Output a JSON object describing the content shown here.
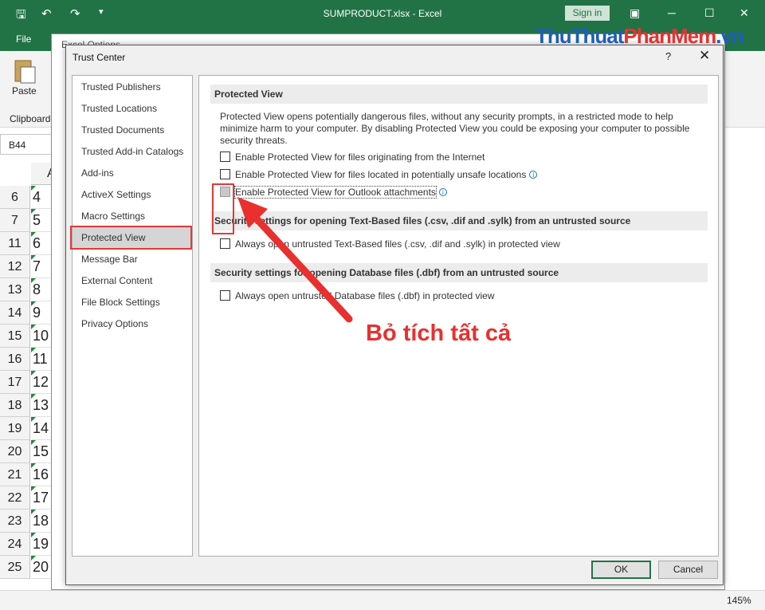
{
  "excel": {
    "doc_title": "SUMPRODUCT.xlsx  -  Excel",
    "sign_in": "Sign in",
    "file_tab": "File",
    "paste": "Paste",
    "clipboard": "Clipboard",
    "name_box": "B44",
    "col_a": "A",
    "rows": [
      {
        "head": "6",
        "val": "4"
      },
      {
        "head": "7",
        "val": "5"
      },
      {
        "head": "11",
        "val": "6"
      },
      {
        "head": "12",
        "val": "7"
      },
      {
        "head": "13",
        "val": "8"
      },
      {
        "head": "14",
        "val": "9"
      },
      {
        "head": "15",
        "val": "10"
      },
      {
        "head": "16",
        "val": "11"
      },
      {
        "head": "17",
        "val": "12"
      },
      {
        "head": "18",
        "val": "13"
      },
      {
        "head": "19",
        "val": "14"
      },
      {
        "head": "20",
        "val": "15"
      },
      {
        "head": "21",
        "val": "16"
      },
      {
        "head": "22",
        "val": "17"
      },
      {
        "head": "23",
        "val": "18"
      },
      {
        "head": "24",
        "val": "19"
      },
      {
        "head": "25",
        "val": "20"
      }
    ],
    "zoom": "145%",
    "accent": "#217346"
  },
  "excel_options": {
    "title": "Excel Options"
  },
  "dialog": {
    "title": "Trust Center",
    "help": "?",
    "close": "✕",
    "nav": [
      "Trusted Publishers",
      "Trusted Locations",
      "Trusted Documents",
      "Trusted Add-in Catalogs",
      "Add-ins",
      "ActiveX Settings",
      "Macro Settings",
      "Protected View",
      "Message Bar",
      "External Content",
      "File Block Settings",
      "Privacy Options"
    ],
    "selected_nav": "Protected View",
    "section1": "Protected View",
    "description": "Protected View opens potentially dangerous files, without any security prompts, in a restricted mode to help minimize harm to your computer. By disabling Protected View you could be exposing your computer to possible security threats.",
    "opt1": "Enable Protected View for files originating from the Internet",
    "opt2": "Enable Protected View for files located in potentially unsafe locations",
    "opt3": "Enable Protected View for Outlook attachments",
    "section2": "Security settings for opening Text-Based files (.csv, .dif and .sylk) from an untrusted source",
    "opt4": "Always open untrusted Text-Based files (.csv, .dif and .sylk) in protected view",
    "section3": "Security settings for opening Database files (.dbf) from an untrusted source",
    "opt5": "Always open untrusted Database files (.dbf) in protected view",
    "ok": "OK",
    "cancel": "Cancel"
  },
  "annotation": {
    "text": "Bỏ tích tất cả",
    "color": "#e8302f"
  },
  "watermark": {
    "part1": "ThuThuat",
    "part2": "PhanMem",
    "part3": ".vn"
  }
}
